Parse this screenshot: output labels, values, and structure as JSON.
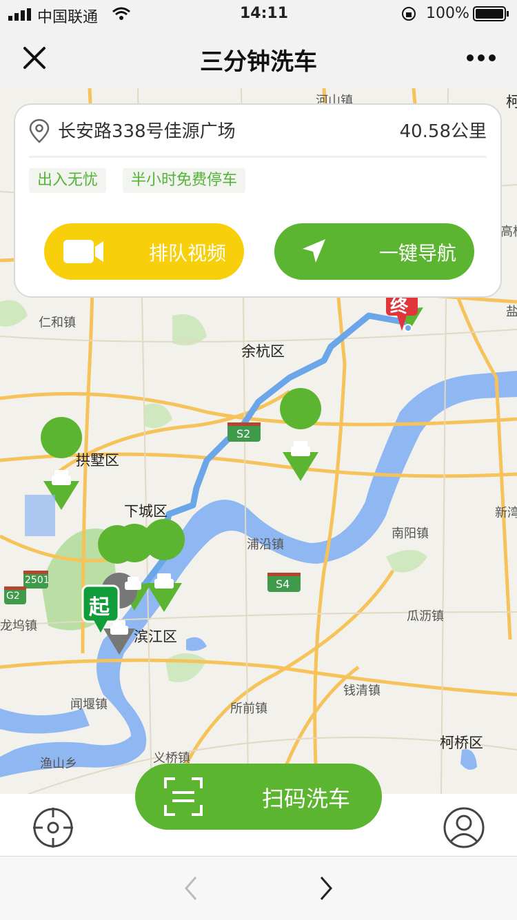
{
  "status_bar": {
    "carrier": "中国联通",
    "time": "14:11",
    "battery": "100%"
  },
  "navbar": {
    "title": "三分钟洗车",
    "close_icon": "close-icon",
    "more_icon": "more-dots-icon"
  },
  "card": {
    "address": "长安路338号佳源广场",
    "distance": "40.58公里",
    "tags": [
      "出入无忧",
      "半小时免费停车"
    ],
    "queue_video_label": "排队视频",
    "navigate_label": "一键导航"
  },
  "map": {
    "labels": {
      "town_top": "河山镇",
      "town_top_right": "柯",
      "renhe": "仁和镇",
      "yuhang": "余杭区",
      "gongshu": "拱墅区",
      "xiacheng": "下城区",
      "nanyang": "南阳镇",
      "xinwan": "新湾",
      "puyan": "浦沿镇",
      "binjiang": "滨江区",
      "guali": "瓜沥镇",
      "longwu": "龙坞镇",
      "qianqing": "钱清镇",
      "xuanqian": "所前镇",
      "wenyan": "闻堰镇",
      "keqiao": "柯桥区",
      "yiqiao": "义桥镇",
      "yushan": "渔山乡",
      "right_edge_1": "高桥",
      "right_edge_2": "盐",
      "start_marker": "起",
      "end_marker": "终"
    },
    "shields": {
      "s2": "S2",
      "s4": "S4",
      "g25": "G2",
      "s01": "2501"
    }
  },
  "bottom": {
    "scan_label": "扫码洗车",
    "locate_icon": "locate-icon",
    "user_icon": "user-icon"
  },
  "colors": {
    "green": "#5cb531",
    "yellow": "#f7cf0b",
    "river": "#8fb7f2",
    "route": "#6aa6e8"
  }
}
